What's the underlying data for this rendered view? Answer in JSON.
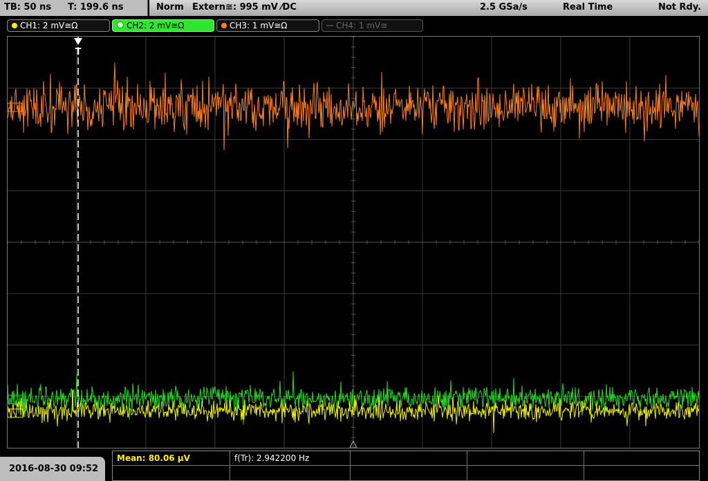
{
  "topbar": {
    "timebase": "TB: 50 ns",
    "trigger_time": "T: 199.6 ns",
    "trigger_mode": "Norm",
    "trigger_source": "Extern≅: 995 mV ⁄DC",
    "sample_rate": "2.5 GSa/s",
    "acq_mode": "Real Time",
    "status": "Not Rdy."
  },
  "channels": [
    {
      "label": "CH1: 2 mV≅Ω",
      "color": "#ffee00"
    },
    {
      "label": "CH2: 2 mV≅Ω",
      "color": "#1fcf1f"
    },
    {
      "label": "CH3: 1 mV≅Ω",
      "color": "#ff7f1f"
    },
    {
      "label": "CH4: 1 mV≅",
      "color": "#555555"
    }
  ],
  "trigger_marker": "T",
  "bottom": {
    "datetime": "2016-08-30 09:52",
    "measurements": [
      {
        "label": "Mean: 80.06 µV"
      },
      {
        "label": "f(Tr): 2.942200 Hz"
      }
    ]
  },
  "traces": {
    "ch3": {
      "color": "#ff7f1f",
      "level_frac": 0.17,
      "amplitude_frac": 0.06
    },
    "ch2": {
      "color": "#22dd22",
      "level_frac": 0.88,
      "amplitude_frac": 0.03
    },
    "ch1": {
      "color": "#f2f200",
      "level_frac": 0.91,
      "amplitude_frac": 0.025
    }
  }
}
